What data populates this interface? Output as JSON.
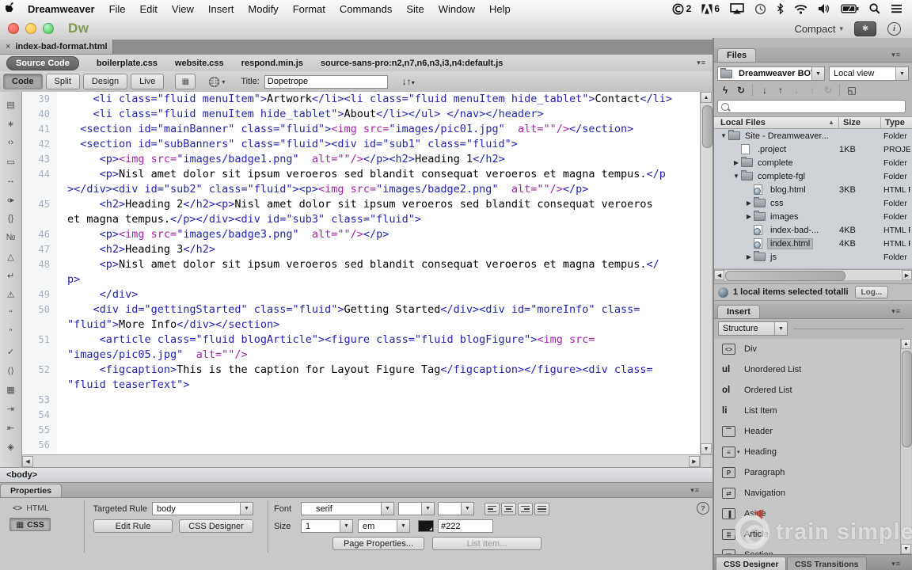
{
  "menubar": {
    "items": [
      "Dreamweaver",
      "File",
      "Edit",
      "View",
      "Insert",
      "Modify",
      "Format",
      "Commands",
      "Site",
      "Window",
      "Help"
    ],
    "status": [
      {
        "name": "creative-cloud-icon",
        "badge": "2"
      },
      {
        "name": "adobe-icon",
        "badge": "6"
      },
      {
        "name": "airplay-icon"
      },
      {
        "name": "time-machine-icon"
      },
      {
        "name": "bluetooth-icon"
      },
      {
        "name": "wifi-icon"
      },
      {
        "name": "volume-icon"
      },
      {
        "name": "battery-icon"
      },
      {
        "name": "spotlight-icon"
      },
      {
        "name": "menu-list-icon"
      }
    ]
  },
  "titlebar": {
    "logo": "Dw",
    "workspace": "Compact"
  },
  "doc_tab": {
    "close": "×",
    "label": "index-bad-format.html"
  },
  "related_files": {
    "selected": "Source Code",
    "files": [
      "boilerplate.css",
      "website.css",
      "respond.min.js",
      "source-sans-pro:n2,n7,n6,n3,i3,n4:default.js"
    ]
  },
  "doc_toolbar": {
    "views": [
      "Code",
      "Split",
      "Design",
      "Live"
    ],
    "active": "Code",
    "title_label": "Title:",
    "title_value": "Dopetrope"
  },
  "coding_toolbar": [
    {
      "name": "open-documents-icon",
      "g": "▤"
    },
    {
      "name": "show-browser-navigation-icon",
      "g": "∗"
    },
    {
      "name": "collapse-full-tag-icon",
      "g": "‹›"
    },
    {
      "name": "collapse-selection-icon",
      "g": "▭"
    },
    {
      "name": "expand-all-icon",
      "g": "↔"
    },
    {
      "name": "select-parent-tag-icon",
      "g": "‹▸"
    },
    {
      "name": "balance-braces-icon",
      "g": "{}"
    },
    {
      "name": "line-numbers-icon",
      "g": "№"
    },
    {
      "name": "highlight-invalid-code-icon",
      "g": "△"
    },
    {
      "name": "word-wrap-icon",
      "g": "↵"
    },
    {
      "name": "syntax-error-alerts-icon",
      "g": "⚠"
    },
    {
      "name": "apply-comment-icon",
      "g": "“"
    },
    {
      "name": "remove-comment-icon",
      "g": "”"
    },
    {
      "name": "wrap-tag-icon",
      "g": "✓"
    },
    {
      "name": "recent-snippets-icon",
      "g": "⟨⟩"
    },
    {
      "name": "move-css-icon",
      "g": "▦"
    },
    {
      "name": "indent-code-icon",
      "g": "⇥"
    },
    {
      "name": "outdent-code-icon",
      "g": "⇤"
    },
    {
      "name": "format-source-code-icon",
      "g": "◈"
    }
  ],
  "code": {
    "rows": [
      {
        "n": "39",
        "s": [
          [
            "g",
            "    <li class=\"fluid menuItem\">"
          ],
          [
            "p",
            "Artwork"
          ],
          [
            "g",
            "</li><li class=\"fluid menuItem hide_tablet\">"
          ],
          [
            "p",
            "Contact"
          ],
          [
            "g",
            "</li>"
          ]
        ]
      },
      {
        "n": "40",
        "s": [
          [
            "g",
            "    <li class=\"fluid menuItem hide_tablet\">"
          ],
          [
            "p",
            "About"
          ],
          [
            "g",
            "</li></ul> </nav></header>"
          ]
        ]
      },
      {
        "n": "41",
        "s": [
          [
            "g",
            "  <section id=\"mainBanner\" class=\"fluid\">"
          ],
          [
            "m",
            "<img src="
          ],
          [
            "g",
            "\"images/pic01.jpg\""
          ],
          [
            "m",
            "  alt=\"\"/>"
          ],
          [
            "g",
            "</section>"
          ]
        ]
      },
      {
        "n": "42",
        "s": [
          [
            "g",
            "  <section id=\"subBanners\" class=\"fluid\"><div id=\"sub1\" class=\"fluid\">"
          ]
        ]
      },
      {
        "n": "43",
        "s": [
          [
            "g",
            "     <p>"
          ],
          [
            "m",
            "<img src="
          ],
          [
            "g",
            "\"images/badge1.png\""
          ],
          [
            "m",
            "  alt=\"\"/>"
          ],
          [
            "g",
            "</p><h2>"
          ],
          [
            "p",
            "Heading 1"
          ],
          [
            "g",
            "</h2>"
          ]
        ]
      },
      {
        "n": "44",
        "s": [
          [
            "g",
            "     <p>"
          ],
          [
            "p",
            "Nisl amet dolor sit ipsum veroeros sed blandit consequat veroeros et magna tempus."
          ],
          [
            "g",
            "</p"
          ]
        ]
      },
      {
        "n": "",
        "s": [
          [
            "g",
            "></div><div id=\"sub2\" class=\"fluid\"><p>"
          ],
          [
            "m",
            "<img src="
          ],
          [
            "g",
            "\"images/badge2.png\""
          ],
          [
            "m",
            "  alt=\"\"/>"
          ],
          [
            "g",
            "</p>"
          ]
        ]
      },
      {
        "n": "45",
        "s": [
          [
            "g",
            "     <h2>"
          ],
          [
            "p",
            "Heading 2"
          ],
          [
            "g",
            "</h2><p>"
          ],
          [
            "p",
            "Nisl amet dolor sit ipsum veroeros sed blandit consequat veroeros"
          ]
        ]
      },
      {
        "n": "",
        "s": [
          [
            "p",
            "et magna tempus."
          ],
          [
            "g",
            "</p></div><div id=\"sub3\" class=\"fluid\">"
          ]
        ]
      },
      {
        "n": "46",
        "s": [
          [
            "g",
            "     <p>"
          ],
          [
            "m",
            "<img src="
          ],
          [
            "g",
            "\"images/badge3.png\""
          ],
          [
            "m",
            "  alt=\"\"/>"
          ],
          [
            "g",
            "</p>"
          ]
        ]
      },
      {
        "n": "47",
        "s": [
          [
            "g",
            "     <h2>"
          ],
          [
            "p",
            "Heading 3"
          ],
          [
            "g",
            "</h2>"
          ]
        ]
      },
      {
        "n": "48",
        "s": [
          [
            "g",
            "     <p>"
          ],
          [
            "p",
            "Nisl amet dolor sit ipsum veroeros sed blandit consequat veroeros et magna tempus."
          ],
          [
            "g",
            "</"
          ]
        ]
      },
      {
        "n": "",
        "s": [
          [
            "g",
            "p>"
          ]
        ]
      },
      {
        "n": "49",
        "s": [
          [
            "g",
            "     </div>"
          ]
        ]
      },
      {
        "n": "50",
        "s": [
          [
            "g",
            "    <div id=\"gettingStarted\" class=\"fluid\">"
          ],
          [
            "p",
            "Getting Started"
          ],
          [
            "g",
            "</div><div id=\"moreInfo\" class="
          ]
        ]
      },
      {
        "n": "",
        "s": [
          [
            "g",
            "\"fluid\">"
          ],
          [
            "p",
            "More Info"
          ],
          [
            "g",
            "</div></section>"
          ]
        ]
      },
      {
        "n": "51",
        "s": [
          [
            "g",
            "     <article class=\"fluid blogArticle\"><figure class=\"fluid blogFigure\">"
          ],
          [
            "m",
            "<img src="
          ]
        ]
      },
      {
        "n": "",
        "s": [
          [
            "g",
            "\"images/pic05.jpg\""
          ],
          [
            "m",
            "  alt=\"\"/>"
          ]
        ]
      },
      {
        "n": "52",
        "s": [
          [
            "g",
            "     <figcaption>"
          ],
          [
            "p",
            "This is the caption for Layout Figure Tag"
          ],
          [
            "g",
            "</figcaption></figure><div class="
          ]
        ]
      },
      {
        "n": "",
        "s": [
          [
            "g",
            "\"fluid teaserText\">"
          ]
        ]
      },
      {
        "n": "53",
        "s": []
      },
      {
        "n": "54",
        "s": []
      },
      {
        "n": "55",
        "s": []
      },
      {
        "n": "56",
        "s": []
      }
    ]
  },
  "tag_selector": "<body>",
  "properties": {
    "tab": "Properties",
    "html_label": "HTML",
    "css_label": "CSS",
    "targeted_rule_label": "Targeted Rule",
    "targeted_rule": "body",
    "edit_rule": "Edit Rule",
    "css_designer": "CSS Designer",
    "font_label": "Font",
    "font": "serif",
    "size_label": "Size",
    "size": "1",
    "unit": "em",
    "color": "#222",
    "page_properties": "Page Properties...",
    "list_item": "List Item..."
  },
  "files_panel": {
    "tab": "Files",
    "site": "Dreamweaver BOTF",
    "view": "Local view",
    "toolbar": [
      {
        "name": "connect-icon",
        "g": "ϟ",
        "muted": false,
        "sep": false
      },
      {
        "name": "refresh-icon",
        "g": "↻",
        "muted": false,
        "sep": true
      },
      {
        "name": "get-files-icon",
        "g": "↓",
        "muted": false,
        "sep": false
      },
      {
        "name": "put-files-icon",
        "g": "↑",
        "muted": false,
        "sep": false
      },
      {
        "name": "check-out-icon",
        "g": "↓",
        "muted": true,
        "sep": false
      },
      {
        "name": "check-in-icon",
        "g": "↑",
        "muted": true,
        "sep": false
      },
      {
        "name": "synchronize-icon",
        "g": "↻",
        "muted": true,
        "sep": true
      },
      {
        "name": "expand-panel-icon",
        "g": "◱",
        "muted": false,
        "sep": false
      }
    ],
    "columns": [
      "Local Files",
      "Size",
      "Type"
    ],
    "rows": [
      {
        "ind": 0,
        "disc": "open",
        "icon": "folder",
        "name": "Site - Dreamweaver...",
        "size": "",
        "type": "Folder",
        "selected": false
      },
      {
        "ind": 1,
        "disc": "",
        "icon": "file",
        "name": ".project",
        "size": "1KB",
        "type": "PROJECT",
        "selected": false
      },
      {
        "ind": 1,
        "disc": "closed",
        "icon": "folder",
        "name": "complete",
        "size": "",
        "type": "Folder",
        "selected": false
      },
      {
        "ind": 1,
        "disc": "open",
        "icon": "folder",
        "name": "complete-fgl",
        "size": "",
        "type": "Folder",
        "selected": false
      },
      {
        "ind": 2,
        "disc": "",
        "icon": "html",
        "name": "blog.html",
        "size": "3KB",
        "type": "HTML Fi",
        "selected": false
      },
      {
        "ind": 2,
        "disc": "closed",
        "icon": "folder",
        "name": "css",
        "size": "",
        "type": "Folder",
        "selected": false
      },
      {
        "ind": 2,
        "disc": "closed",
        "icon": "folder",
        "name": "images",
        "size": "",
        "type": "Folder",
        "selected": false
      },
      {
        "ind": 2,
        "disc": "",
        "icon": "html",
        "name": "index-bad-...",
        "size": "4KB",
        "type": "HTML Fi",
        "selected": false
      },
      {
        "ind": 2,
        "disc": "",
        "icon": "html",
        "name": "index.html",
        "size": "4KB",
        "type": "HTML Fi",
        "selected": true
      },
      {
        "ind": 2,
        "disc": "closed",
        "icon": "folder",
        "name": "js",
        "size": "",
        "type": "Folder",
        "selected": false
      }
    ],
    "status": "1 local items selected totalli",
    "log": "Log..."
  },
  "insert_panel": {
    "tab": "Insert",
    "category": "Structure",
    "items": [
      {
        "name": "div",
        "label": "Div",
        "dd": false
      },
      {
        "name": "unordered-list",
        "label": "Unordered List",
        "dd": false
      },
      {
        "name": "ordered-list",
        "label": "Ordered List",
        "dd": false
      },
      {
        "name": "list-item",
        "label": "List Item",
        "dd": false
      },
      {
        "name": "header",
        "label": "Header",
        "dd": false
      },
      {
        "name": "heading",
        "label": "Heading",
        "dd": true
      },
      {
        "name": "paragraph",
        "label": "Paragraph",
        "dd": false
      },
      {
        "name": "navigation",
        "label": "Navigation",
        "dd": false
      },
      {
        "name": "aside",
        "label": "Aside",
        "dd": false
      },
      {
        "name": "article",
        "label": "Article",
        "dd": false
      },
      {
        "name": "section",
        "label": "Section",
        "dd": false
      }
    ]
  },
  "bottom_tabs": [
    "CSS Designer",
    "CSS Transitions"
  ],
  "watermark": "train simple",
  "colors": {
    "code_tag": "#2323b0",
    "code_entity": "#a424a8",
    "code_text": "#000000",
    "logo_green": "#7d9a50",
    "selection": "#b2b6ba"
  }
}
